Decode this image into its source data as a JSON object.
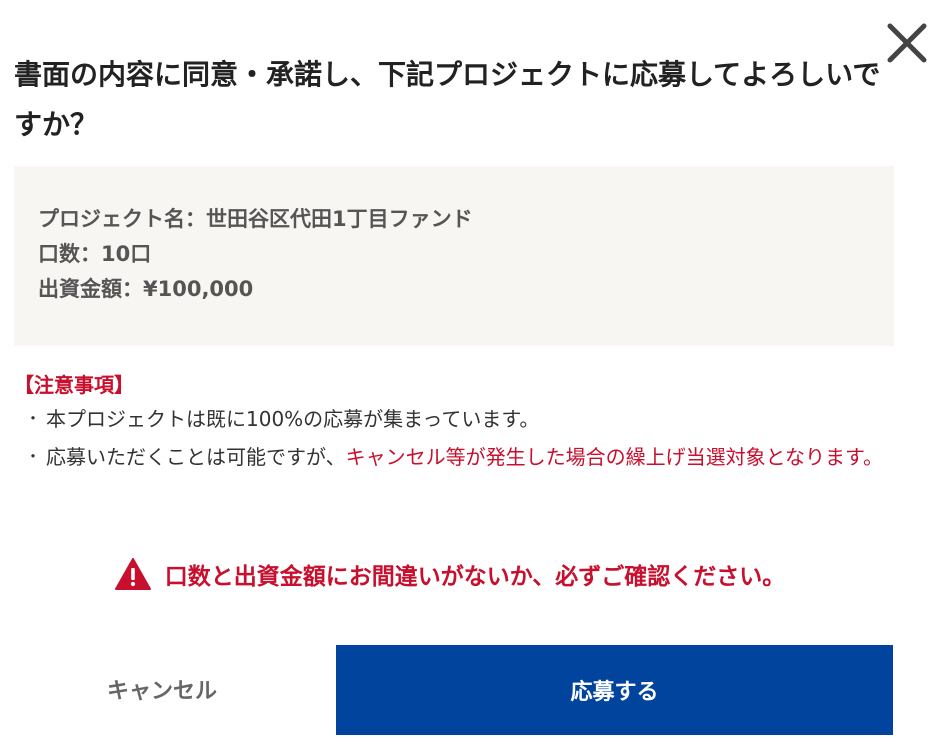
{
  "dialog": {
    "close_icon": "close-icon",
    "title": "書面の内容に同意・承諾し、下記プロジェクトに応募してよろしいですか？"
  },
  "summary": {
    "project_name": "プロジェクト名：世田谷区代田1丁目ファンド",
    "units": "口数：10口",
    "amount": "出資金額：¥100,000"
  },
  "notes": {
    "heading": "【注意事項】",
    "bullet": "・",
    "item1": "本プロジェクトは既に100%の応募が集まっています。",
    "item2_prefix": "応募いただくことは可能ですが、",
    "item2_highlight": "キャンセル等が発生した場合の繰上げ当選対象となります。"
  },
  "warning": {
    "icon": "warning-icon",
    "text": "口数と出資金額にお間違いがないか、必ずご確認ください。"
  },
  "buttons": {
    "cancel": "キャンセル",
    "apply": "応募する"
  },
  "colors": {
    "accent_red": "#c8102e",
    "primary_blue": "#00449e",
    "summary_bg": "#f8f6f2"
  }
}
